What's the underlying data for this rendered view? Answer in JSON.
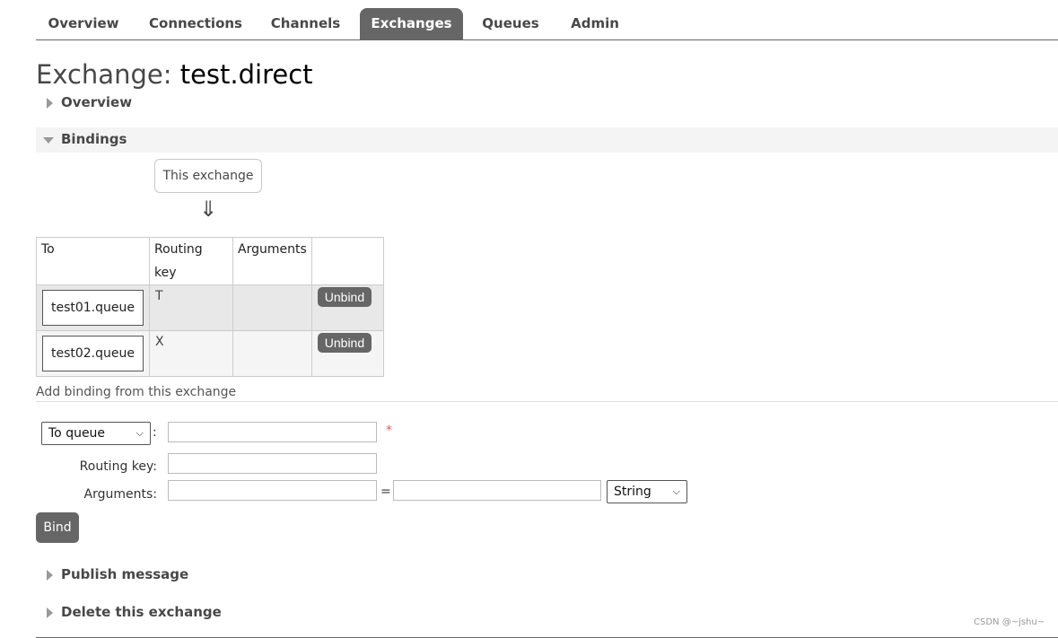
{
  "nav": {
    "tabs": [
      {
        "label": "Overview",
        "active": false
      },
      {
        "label": "Connections",
        "active": false
      },
      {
        "label": "Channels",
        "active": false
      },
      {
        "label": "Exchanges",
        "active": true
      },
      {
        "label": "Queues",
        "active": false
      },
      {
        "label": "Admin",
        "active": false
      }
    ]
  },
  "page": {
    "title_prefix": "Exchange: ",
    "exchange_name": "test.direct"
  },
  "sections": {
    "overview": "Overview",
    "bindings": "Bindings",
    "publish": "Publish message",
    "delete": "Delete this exchange"
  },
  "bindings": {
    "source_label": "This exchange",
    "arrow": "⇓",
    "columns": [
      "To",
      "Routing key",
      "Arguments",
      ""
    ],
    "rows": [
      {
        "to": "test01.queue",
        "routing_key": "T",
        "arguments": "",
        "action": "Unbind"
      },
      {
        "to": "test02.queue",
        "routing_key": "X",
        "arguments": "",
        "action": "Unbind"
      }
    ]
  },
  "add_binding": {
    "heading": "Add binding from this exchange",
    "destination_type": "To queue",
    "destination_colon": ":",
    "destination_value": "",
    "required_mark": "*",
    "routing_key_label": "Routing key:",
    "routing_key_value": "",
    "arguments_label": "Arguments:",
    "arg_key": "",
    "arg_equals": "=",
    "arg_value": "",
    "arg_type": "String",
    "bind_label": "Bind"
  },
  "watermark": "CSDN @~jshu~",
  "colors": {
    "tab_active_bg": "#666666",
    "section_open_bg": "#f4f4f4",
    "button_bg": "#666666"
  }
}
